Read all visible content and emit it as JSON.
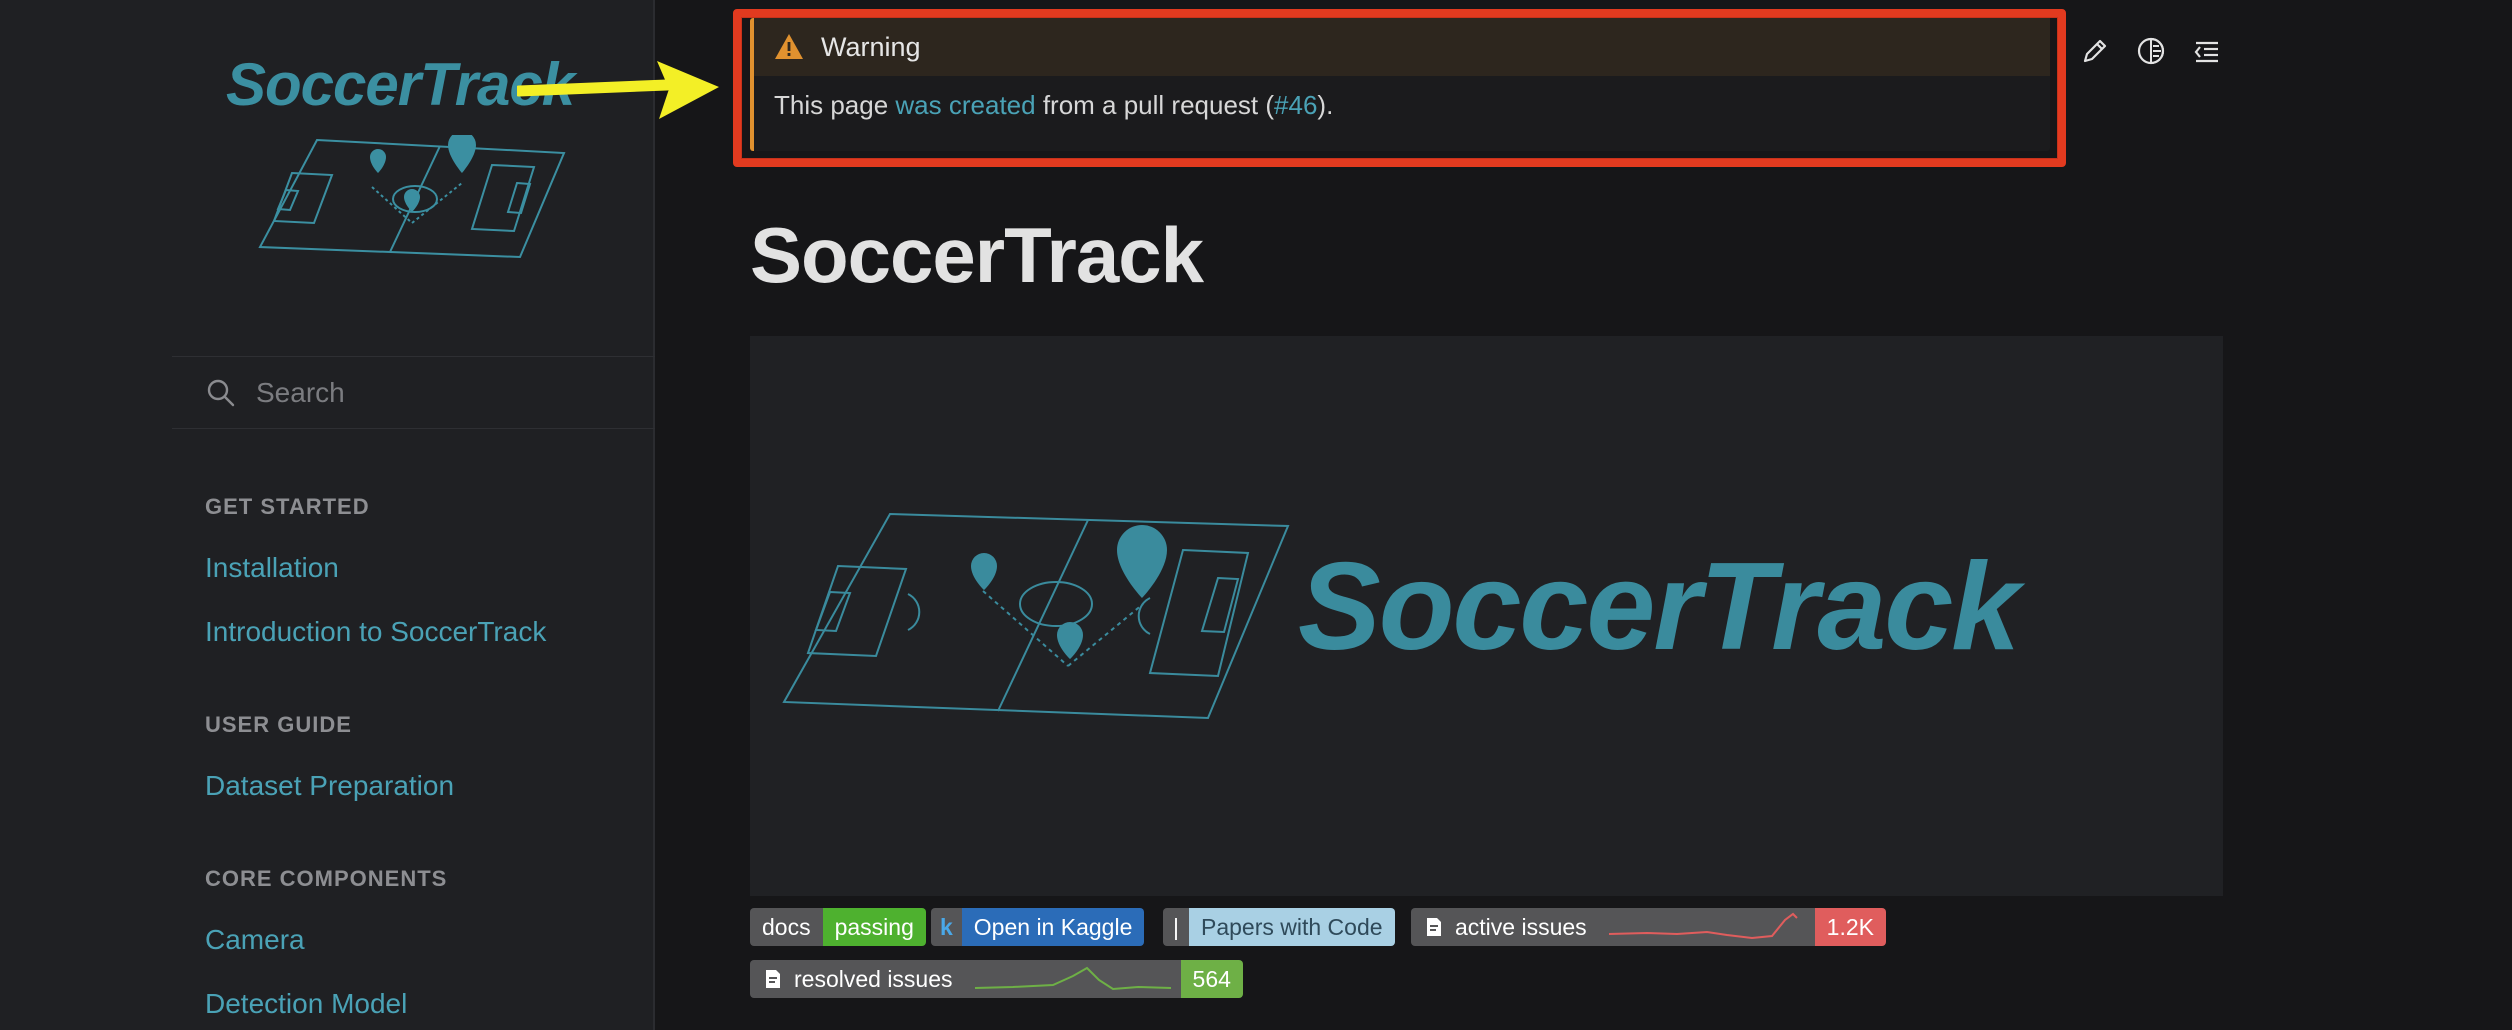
{
  "sidebar": {
    "logo_text": "SoccerTrack",
    "search_placeholder": "Search",
    "sections": [
      {
        "heading": "GET STARTED",
        "items": [
          "Installation",
          "Introduction to SoccerTrack"
        ]
      },
      {
        "heading": "USER GUIDE",
        "items": [
          "Dataset Preparation"
        ]
      },
      {
        "heading": "CORE COMPONENTS",
        "items": [
          "Camera",
          "Detection Model"
        ]
      }
    ]
  },
  "admonition": {
    "title": "Warning",
    "text_before": "This page ",
    "link_created": "was created",
    "text_middle": " from a pull request (",
    "link_pr": "#46",
    "text_after": ")."
  },
  "toolbar": {
    "icons": [
      "edit-icon",
      "theme-toggle-icon",
      "outline-icon"
    ]
  },
  "page": {
    "title": "SoccerTrack",
    "hero_text": "SoccerTrack"
  },
  "badges": {
    "docs": {
      "label": "docs",
      "value": "passing",
      "color": "#4eb12f"
    },
    "kaggle": {
      "label": "k",
      "value": "Open in Kaggle",
      "color": "#2b6cb8"
    },
    "pwc": {
      "label": "|",
      "value": "Papers with Code",
      "color": "#a9d0e4"
    },
    "active": {
      "label": "active issues",
      "value": "1.2K",
      "color": "#e05d5d"
    },
    "resolved": {
      "label": "resolved issues",
      "value": "564",
      "color": "#6eb046"
    }
  },
  "colors": {
    "accent": "#4aa2b6",
    "warning": "#e0912f",
    "highlight": "#e23a1f",
    "arrow": "#f3ef26"
  }
}
